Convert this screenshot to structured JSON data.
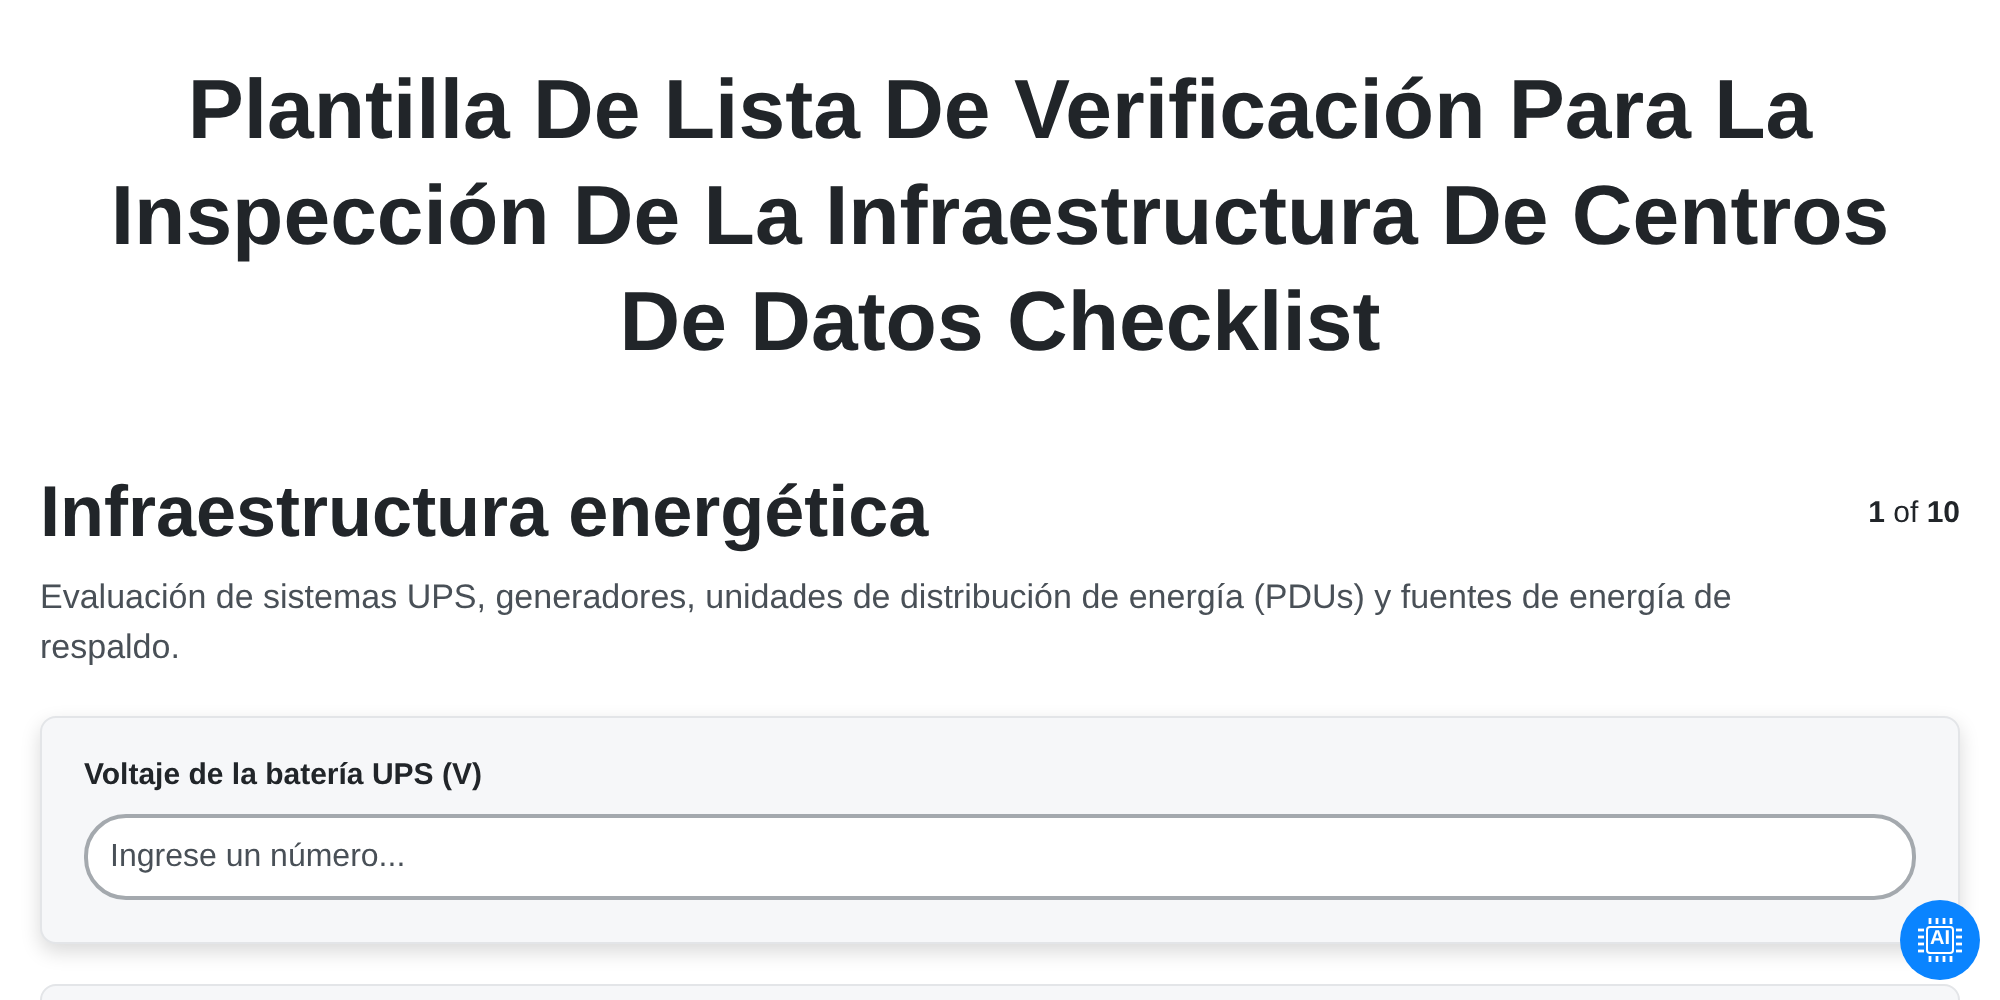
{
  "title": "Plantilla De Lista De Verificación Para La Inspección De La Infraestructura De Centros De Datos Checklist",
  "section": {
    "heading": "Infraestructura energética",
    "pager": "**1** of **10**",
    "description": "Evaluación de sistemas UPS, generadores, unidades de distribución de energía (PDUs) y fuentes de energía de respaldo."
  },
  "fields": [
    {
      "label": "Voltaje de la batería UPS (V)",
      "placeholder": "Ingrese un número..."
    }
  ],
  "ai_button": {
    "label": "AI"
  }
}
